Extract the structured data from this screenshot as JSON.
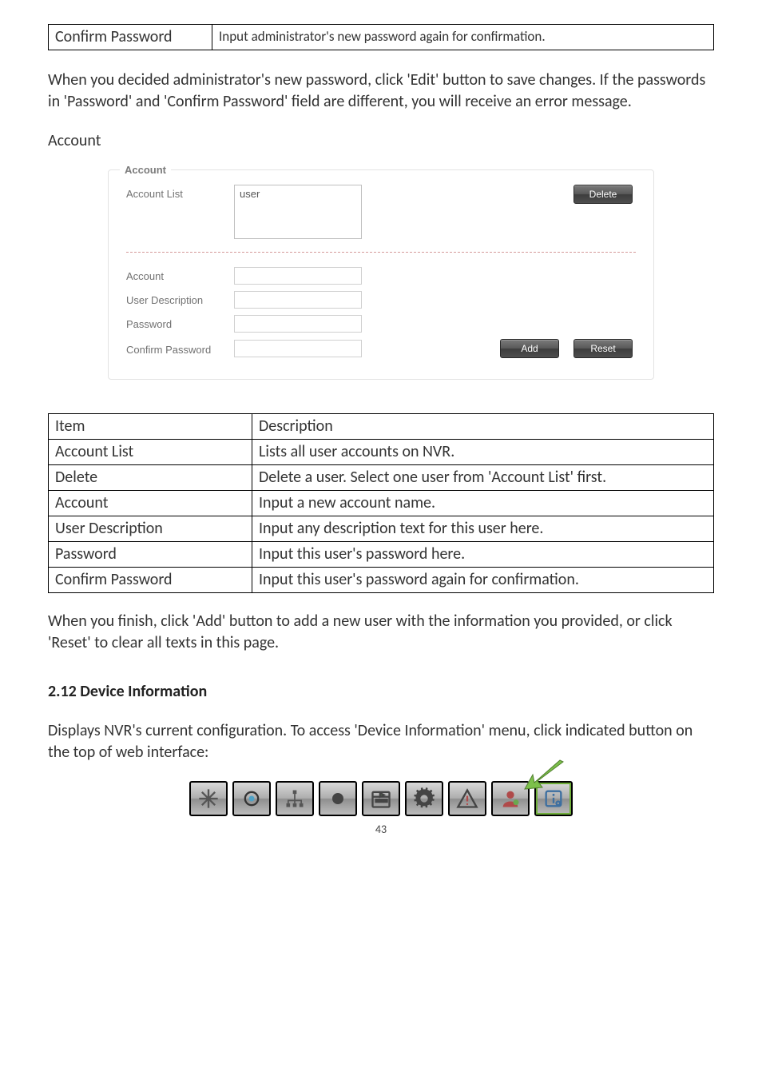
{
  "mini_table": {
    "col1": "Confirm Password",
    "col2": "Input administrator's new password again for confirmation."
  },
  "para1": "When you decided administrator's new password, click 'Edit' button to save changes. If the passwords in 'Password' and 'Confirm Password' field are different, you will receive an error message.",
  "sub_account": "Account",
  "fieldset": {
    "legend": "Account",
    "account_list_label": "Account List",
    "list_item": "user",
    "delete": "Delete",
    "account_label": "Account",
    "user_desc_label": "User Description",
    "password_label": "Password",
    "confirm_label": "Confirm Password",
    "add": "Add",
    "reset": "Reset"
  },
  "desc_table": {
    "header": {
      "item": "Item",
      "desc": "Description"
    },
    "rows": [
      {
        "item": "Account List",
        "desc": "Lists all user accounts on NVR."
      },
      {
        "item": "Delete",
        "desc": "Delete a user. Select one user from 'Account List' first."
      },
      {
        "item": "Account",
        "desc": "Input a new account name."
      },
      {
        "item": "User Description",
        "desc": "Input any description text for this user here."
      },
      {
        "item": "Password",
        "desc": "Input this user's password here."
      },
      {
        "item": "Confirm Password",
        "desc": "Input this user's password again for confirmation."
      }
    ]
  },
  "para2": "When you finish, click 'Add' button to add a new user with the information you provided, or click 'Reset' to clear all texts in this page.",
  "section_head": "2.12 Device Information",
  "para3": "Displays NVR's current configuration. To access 'Device Information' menu, click indicated button on the top of web interface:",
  "page_number": "43"
}
